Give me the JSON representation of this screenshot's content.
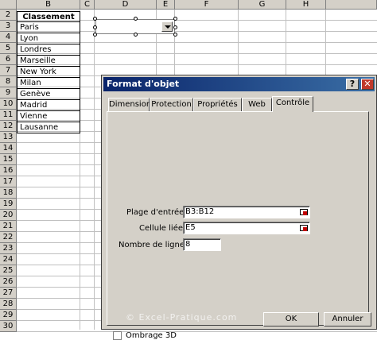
{
  "sheet": {
    "columns": [
      "B",
      "C",
      "D",
      "E",
      "F",
      "G",
      "H"
    ],
    "rows": [
      "2",
      "3",
      "4",
      "5",
      "6",
      "7",
      "8",
      "9",
      "10",
      "11",
      "12",
      "13",
      "14",
      "15",
      "16",
      "17",
      "18",
      "19",
      "20",
      "21",
      "22",
      "23",
      "24",
      "25",
      "26",
      "27",
      "28",
      "29",
      "30"
    ],
    "header_cell": "Classement",
    "cities": [
      "Paris",
      "Lyon",
      "Londres",
      "Marseille",
      "New York",
      "Milan",
      "Genève",
      "Madrid",
      "Vienne",
      "Lausanne"
    ]
  },
  "dialog": {
    "title": "Format d'objet",
    "help_label": "?",
    "close_label": "✕",
    "tabs": [
      "Dimension",
      "Protection",
      "Propriétés",
      "Web",
      "Contrôle"
    ],
    "active_tab": "Contrôle",
    "fields": {
      "input_range_label": "Plage d'entrée :",
      "input_range_value": "B3:B12",
      "linked_cell_label": "Cellule liée :",
      "linked_cell_value": "E5",
      "line_count_label": "Nombre de lignes :",
      "line_count_value": "8"
    },
    "shading_label": "Ombrage 3D",
    "ok_label": "OK",
    "cancel_label": "Annuler"
  },
  "watermark": "© Excel-Pratique.com"
}
